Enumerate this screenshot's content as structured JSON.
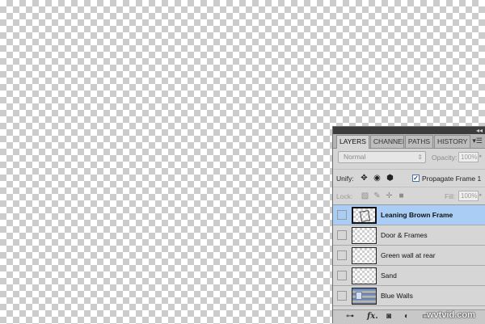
{
  "panel": {
    "tabs": [
      {
        "label": "LAYERS",
        "active": true
      },
      {
        "label": "CHANNELS",
        "active": false
      },
      {
        "label": "PATHS",
        "active": false
      },
      {
        "label": "HISTORY",
        "active": false
      }
    ],
    "menu_icon": "panel-menu-icon",
    "collapse_icon": "double-chevron-icon"
  },
  "blend": {
    "mode": "Normal",
    "opacity_label": "Opacity:",
    "opacity_value": "100%"
  },
  "unify": {
    "label": "Unify:",
    "icons": [
      "unify-position-icon",
      "unify-visibility-icon",
      "unify-style-icon"
    ],
    "propagate_label": "Propagate Frame 1",
    "propagate_checked": true
  },
  "lock": {
    "label": "Lock:",
    "icons": [
      "lock-transparent-icon",
      "lock-image-icon",
      "lock-position-icon",
      "lock-all-icon"
    ],
    "fill_label": "Fill:",
    "fill_value": "100%"
  },
  "layers": [
    {
      "name": "Leaning Brown Frame",
      "selected": true,
      "thumb": "transparent"
    },
    {
      "name": "Door & Frames",
      "selected": false,
      "thumb": "transparent"
    },
    {
      "name": "Green wall at rear",
      "selected": false,
      "thumb": "transparent"
    },
    {
      "name": "Sand",
      "selected": false,
      "thumb": "transparent"
    },
    {
      "name": "Blue Walls",
      "selected": false,
      "thumb": "photo"
    }
  ],
  "bottom_icons": [
    "link-layers-icon",
    "fx-icon",
    "layer-mask-icon",
    "adjustment-layer-icon",
    "new-group-icon"
  ],
  "watermark": "wvtvid.com"
}
